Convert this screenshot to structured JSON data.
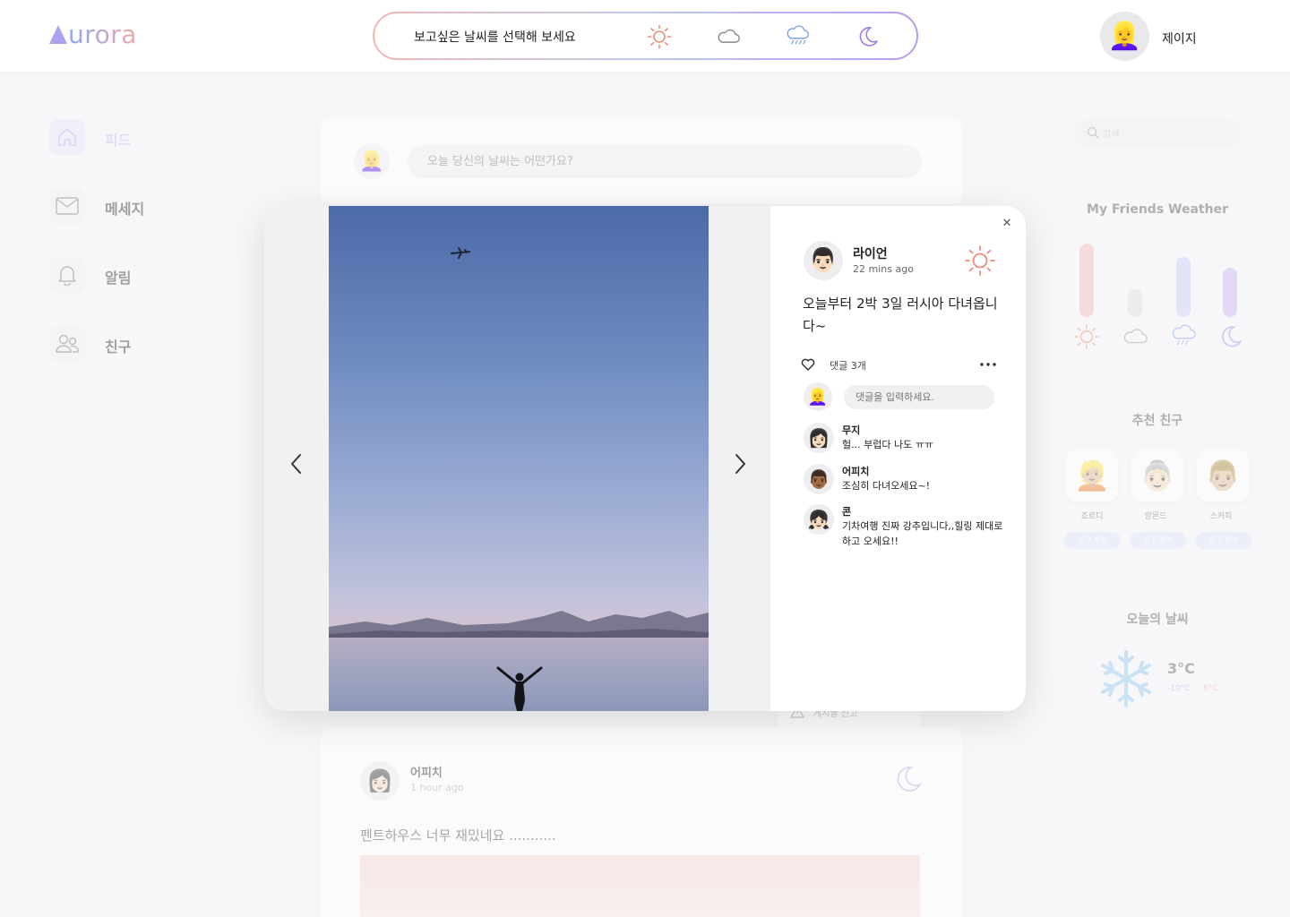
{
  "header": {
    "logo_first": "A",
    "logo_rest": "urora",
    "weather_prompt": "보고싶은 날씨를 선택해 보세요",
    "weather_options": [
      "sun-icon",
      "cloud-icon",
      "rain-cloud-icon",
      "moon-icon"
    ],
    "user_name": "제이지",
    "user_avatar": "👱‍♀️"
  },
  "sidebar": {
    "items": [
      {
        "label": "피드",
        "icon": "home-icon",
        "active": true
      },
      {
        "label": "메세지",
        "icon": "mail-icon",
        "active": false
      },
      {
        "label": "알림",
        "icon": "bell-icon",
        "active": false
      },
      {
        "label": "친구",
        "icon": "friends-icon",
        "active": false
      }
    ]
  },
  "composer": {
    "avatar": "👱‍♀️",
    "placeholder": "오늘 당신의 날씨는 어떤가요?"
  },
  "modal": {
    "post": {
      "author": "라이언",
      "time": "22 mins ago",
      "avatar": "👨🏻",
      "weather": "sun-icon",
      "text": "오늘부터 2박 3일 러시아 다녀옵니다~"
    },
    "comment_count": "댓글 3개",
    "my_avatar": "👱‍♀️",
    "comment_placeholder": "댓글을 입력하세요.",
    "comments": [
      {
        "author": "무지",
        "text": "헐... 부럽다 나도 ㅠㅠ",
        "avatar": "👩🏻"
      },
      {
        "author": "어피치",
        "text": "조심히 다녀오세요~!",
        "avatar": "👨🏾"
      },
      {
        "author": "콘",
        "text": "기차여행 진짜 강추입니다,,힐링 제대로 하고 오세요!!",
        "avatar": "👧🏻"
      }
    ]
  },
  "report": {
    "label": "게시물 신고"
  },
  "feed_post": {
    "author": "어피치",
    "time": "1 hour ago",
    "avatar": "👩🏻",
    "weather": "moon-icon",
    "text": "펜트하우스 너무 재밌네요 ..........."
  },
  "right": {
    "search_placeholder": "검색",
    "friends_weather_title": "My Friends Weather",
    "friends_weather": [
      {
        "weather": "sun-icon",
        "level": 0.98,
        "color": "#f3b7b7"
      },
      {
        "weather": "cloud-icon",
        "level": 0.37,
        "color": "#dcdcdc"
      },
      {
        "weather": "rain-cloud-icon",
        "level": 0.8,
        "color": "#c4cdf6"
      },
      {
        "weather": "moon-icon",
        "level": 0.65,
        "color": "#c9b3f2"
      }
    ],
    "recommend_title": "추천 친구",
    "recommend": [
      {
        "name": "죠르디",
        "avatar": "👱🏼",
        "button": "친구 추가"
      },
      {
        "name": "앙몬드",
        "avatar": "👵🏻",
        "button": "친구 추가"
      },
      {
        "name": "스카피",
        "avatar": "👨🏼",
        "button": "친구 추가"
      }
    ],
    "today_title": "오늘의 날씨",
    "today_temp": "3°C",
    "today_low": "-10°C",
    "today_high": "6°C"
  }
}
